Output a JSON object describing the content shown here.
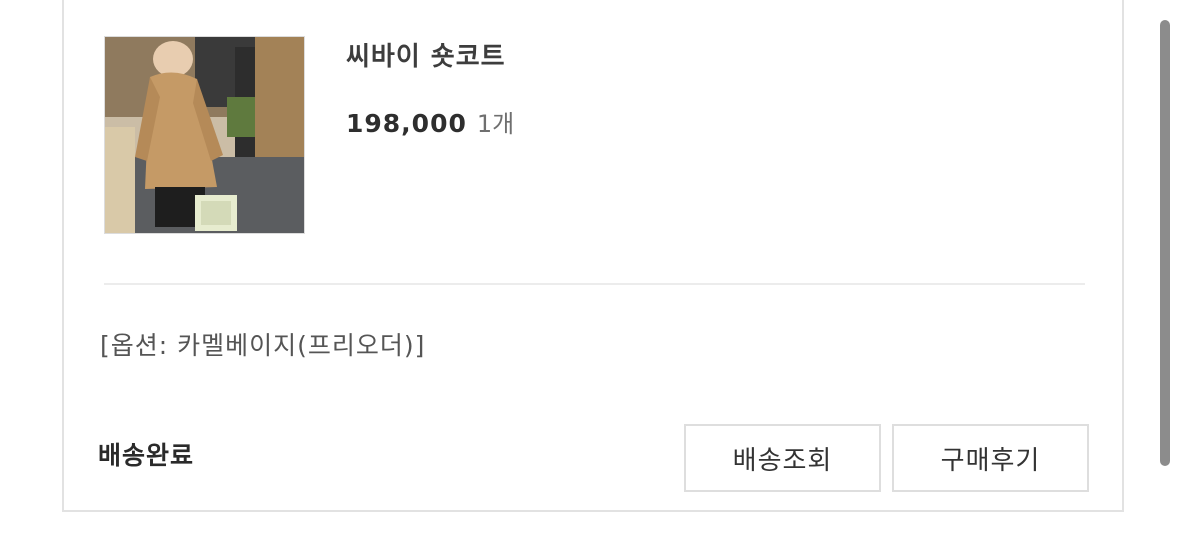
{
  "product": {
    "name": "씨바이 숏코트",
    "price": "198,000",
    "quantity": "1개",
    "image_label": "product-photo"
  },
  "order": {
    "option": "[옵션: 카멜베이지(프리오더)]",
    "status": "배송완료"
  },
  "actions": {
    "track_label": "배송조회",
    "review_label": "구매후기"
  },
  "colors": {
    "accent": "#2e2e2e",
    "border": "#dedede",
    "scrollbar": "#8c8c8c"
  }
}
